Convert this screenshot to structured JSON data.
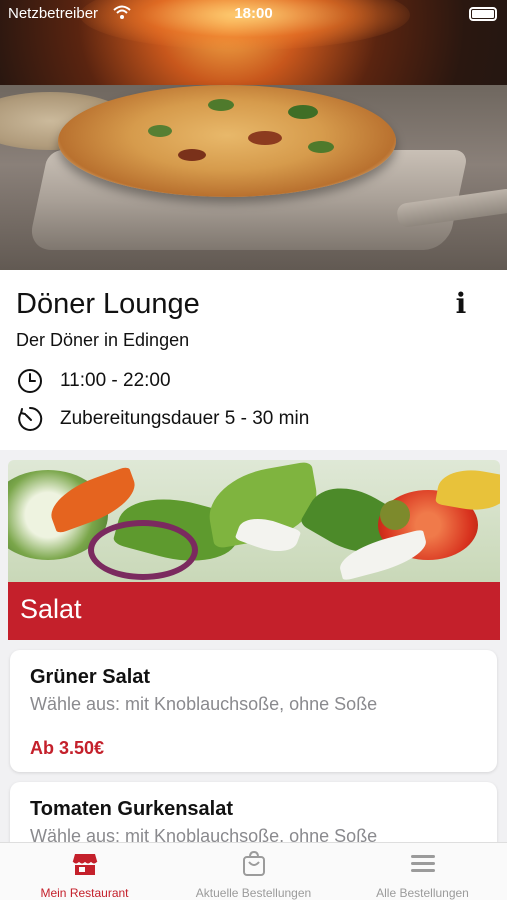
{
  "status_bar": {
    "carrier": "Netzbetreiber",
    "time": "18:00",
    "icons": [
      "wifi-icon",
      "battery-icon"
    ]
  },
  "restaurant": {
    "name": "Döner Lounge",
    "tagline": "Der Döner in Edingen",
    "opening_hours": "11:00 - 22:00",
    "preparation_time": "Zubereitungsdauer 5 - 30 min",
    "icons": {
      "info": "info-icon",
      "hours": "clock-icon",
      "prep": "timer-icon"
    }
  },
  "category": {
    "title": "Salat"
  },
  "products": [
    {
      "title": "Grüner Salat",
      "description": "Wähle aus: mit Knoblauchsoße, ohne Soße",
      "price": "Ab 3.50€"
    },
    {
      "title": "Tomaten Gurkensalat",
      "description": "Wähle aus: mit Knoblauchsoße, ohne Soße"
    }
  ],
  "tab_bar": {
    "tabs": [
      {
        "label": "Mein Restaurant",
        "icon": "store-icon",
        "active": true
      },
      {
        "label": "Aktuelle Bestellungen",
        "icon": "shopping-bag-icon",
        "active": false
      },
      {
        "label": "Alle Bestellungen",
        "icon": "menu-icon",
        "active": false
      }
    ]
  },
  "colors": {
    "accent": "#c4202b",
    "background": "#f1f1f3",
    "secondary_text": "#8a8a8e"
  }
}
